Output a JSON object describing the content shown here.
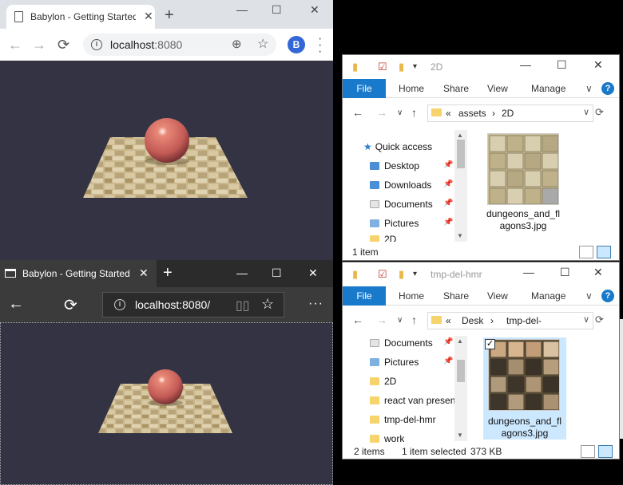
{
  "chrome": {
    "tab_title": "Babylon - Getting Started",
    "new_tab": "+",
    "close": "✕",
    "minimize": "—",
    "maximize": "☐",
    "url_host": "localhost",
    "url_port": ":8080",
    "avatar_letter": "B",
    "colors": {
      "viewport": "#333344",
      "tabbar": "#dee1e6"
    }
  },
  "edge": {
    "tab_title": "Babylon - Getting Started",
    "close": "✕",
    "new_tab": "+",
    "minimize": "—",
    "maximize": "☐",
    "url": "localhost:8080/",
    "more": "···",
    "colors": {
      "viewport": "#333344",
      "chrome": "#3b3b3b"
    }
  },
  "explorer1": {
    "title": "2D",
    "file_tab": "File",
    "ribbon_tabs": [
      "Home",
      "Share",
      "View",
      "Manage"
    ],
    "help": "?",
    "breadcrumb": [
      "«",
      "assets",
      "›",
      "2D"
    ],
    "tree": [
      {
        "label": "Quick access",
        "icon": "star-icon"
      },
      {
        "label": "Desktop",
        "icon": "desktop-icon",
        "pinned": true
      },
      {
        "label": "Downloads",
        "icon": "downloads-icon",
        "pinned": true
      },
      {
        "label": "Documents",
        "icon": "documents-icon",
        "pinned": true
      },
      {
        "label": "Pictures",
        "icon": "pictures-icon",
        "pinned": true
      },
      {
        "label": "2D",
        "icon": "folder-icon"
      }
    ],
    "file_name_line1": "dungeons_and_fl",
    "file_name_line2": "agons3.jpg",
    "status": "1 item"
  },
  "explorer2": {
    "title": "tmp-del-hmr",
    "file_tab": "File",
    "ribbon_tabs": [
      "Home",
      "Share",
      "View",
      "Manage"
    ],
    "help": "?",
    "breadcrumb": [
      "«",
      "Desk",
      "›",
      "tmp-del-"
    ],
    "tree": [
      {
        "label": "Documents",
        "icon": "documents-icon",
        "pinned": true
      },
      {
        "label": "Pictures",
        "icon": "pictures-icon",
        "pinned": true
      },
      {
        "label": "2D",
        "icon": "folder-icon"
      },
      {
        "label": "react van presen",
        "icon": "folder-icon"
      },
      {
        "label": "tmp-del-hmr",
        "icon": "folder-icon"
      },
      {
        "label": "work",
        "icon": "folder-icon"
      }
    ],
    "file_name_line1": "dungeons_and_fl",
    "file_name_line2": "agons3.jpg",
    "status_count": "2 items",
    "status_selected": "1 item selected",
    "status_size": "373 KB"
  }
}
